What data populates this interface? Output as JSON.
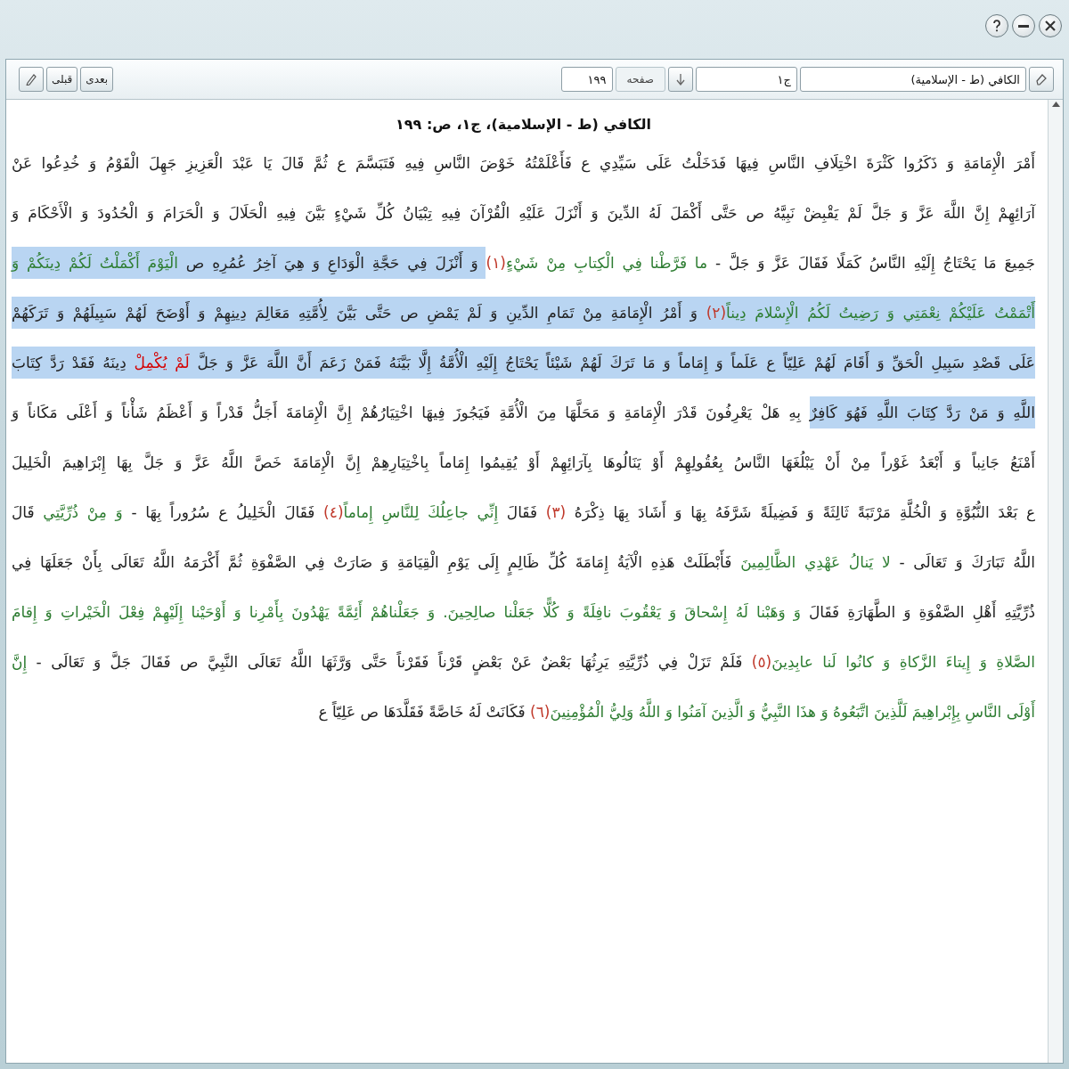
{
  "toolbar": {
    "book": "الكافي (ط - الإسلامية)",
    "volume": "ج١",
    "page_label": "صفحه",
    "page": "١٩٩",
    "prev": "قبلى",
    "next": "بعدى"
  },
  "document": {
    "heading": "الكافي (ط - الإسلامية)، ج١، ص: ١٩٩",
    "lines": [
      {
        "segments": [
          {
            "kind": "plain",
            "selected": false,
            "text": "أَمْرَ الْإِمَامَةِ وَ ذَكَرُوا كَثْرَةَ اخْتِلَافِ النَّاسِ فِيهَا فَدَخَلْتُ عَلَى سَيِّدِي ع فَأَعْلَمْتُهُ خَوْضَ النَّاسِ فِيهِ فَتَبَسَّمَ ع ثُمَّ قَالَ يَا عَبْدَ الْعَزِيزِ جَهِلَ الْقَوْمُ وَ خُدِعُوا عَنْ"
          }
        ]
      },
      {
        "segments": [
          {
            "kind": "plain",
            "selected": false,
            "text": "آرَائِهِمْ إِنَّ اللَّهَ عَزَّ وَ جَلَّ لَمْ يَقْبِضْ نَبِيَّهُ ص حَتَّى أَكْمَلَ لَهُ الدِّينَ وَ أَنْزَلَ عَلَيْهِ الْقُرْآنَ فِيهِ تِبْيَانُ كُلِّ شَيْءٍ بَيَّنَ فِيهِ الْحَلَالَ وَ الْحَرَامَ وَ الْحُدُودَ وَ الْأَحْكَامَ وَ"
          }
        ]
      },
      {
        "segments": [
          {
            "kind": "plain",
            "selected": false,
            "text": "جَمِيعَ مَا يَحْتَاجُ إِلَيْهِ النَّاسُ كَمَلًا فَقَالَ عَزَّ وَ جَلَّ - "
          },
          {
            "kind": "quran",
            "selected": false,
            "text": "ما فَرَّطْنا فِي الْكِتابِ مِنْ شَيْءٍ"
          },
          {
            "kind": "note",
            "selected": false,
            "text": "(١)"
          },
          {
            "kind": "plain",
            "selected": true,
            "text": " وَ أَنْزَلَ فِي حَجَّةِ الْوَدَاعِ وَ هِيَ آخِرُ عُمُرِهِ ص "
          },
          {
            "kind": "quran",
            "selected": true,
            "text": "الْيَوْمَ أَكْمَلْتُ لَكُمْ دِينَكُمْ وَ"
          }
        ]
      },
      {
        "segments": [
          {
            "kind": "quran",
            "selected": true,
            "text": "أَتْمَمْتُ عَلَيْكُمْ نِعْمَتِي وَ رَضِيتُ لَكُمُ الْإِسْلامَ دِيناً"
          },
          {
            "kind": "note",
            "selected": true,
            "text": "(٢)"
          },
          {
            "kind": "plain",
            "selected": true,
            "text": " وَ أَمْرُ الْإِمَامَةِ مِنْ تَمَامِ الدِّينِ وَ لَمْ يَمْضِ ص حَتَّى بَيَّنَ لِأُمَّتِهِ مَعَالِمَ دِينِهِمْ وَ أَوْضَحَ لَهُمْ سَبِيلَهُمْ وَ تَرَكَهُمْ"
          }
        ]
      },
      {
        "segments": [
          {
            "kind": "plain",
            "selected": true,
            "text": "عَلَى قَصْدِ سَبِيلِ الْحَقِّ وَ أَقَامَ لَهُمْ عَلِيّاً ع عَلَماً وَ إِمَاماً وَ مَا تَرَكَ لَهُمْ شَيْئاً يَحْتَاجُ إِلَيْهِ الْأُمَّةُ إِلَّا بَيَّنَهُ فَمَنْ زَعَمَ أَنَّ اللَّهَ عَزَّ وَ جَلَّ "
          },
          {
            "kind": "red",
            "selected": true,
            "text": "لَمْ يُكْمِلْ"
          },
          {
            "kind": "plain",
            "selected": true,
            "text": " دِينَهُ فَقَدْ رَدَّ كِتَابَ"
          }
        ]
      },
      {
        "segments": [
          {
            "kind": "plain",
            "selected": true,
            "text": "اللَّهِ وَ مَنْ رَدَّ كِتَابَ اللَّهِ فَهُوَ كَافِرٌ"
          },
          {
            "kind": "plain",
            "selected": false,
            "text": " بِهِ هَلْ يَعْرِفُونَ قَدْرَ الْإِمَامَةِ وَ مَحَلَّهَا مِنَ الْأُمَّةِ فَيَجُوزَ فِيهَا اخْتِيَارُهُمْ إِنَّ الْإِمَامَةَ أَجَلُّ قَدْراً وَ أَعْظَمُ شَأْناً وَ أَعْلَى مَكَاناً وَ"
          }
        ]
      },
      {
        "segments": [
          {
            "kind": "plain",
            "selected": false,
            "text": "أَمْنَعُ جَانِباً وَ أَبْعَدُ غَوْراً مِنْ أَنْ يَبْلُغَهَا النَّاسُ بِعُقُولِهِمْ أَوْ يَنَالُوهَا بِآرَائِهِمْ أَوْ يُقِيمُوا إِمَاماً بِاخْتِيَارِهِمْ إِنَّ الْإِمَامَةَ خَصَّ اللَّهُ عَزَّ وَ جَلَّ بِهَا إِبْرَاهِيمَ الْخَلِيلَ"
          }
        ]
      },
      {
        "segments": [
          {
            "kind": "plain",
            "selected": false,
            "text": "ع بَعْدَ النُّبُوَّةِ وَ الْخُلَّةِ مَرْتَبَةً ثَالِثَةً وَ فَضِيلَةً شَرَّفَهُ بِهَا وَ أَشَادَ بِهَا ذِكْرَهُ "
          },
          {
            "kind": "note",
            "selected": false,
            "text": "(٣)"
          },
          {
            "kind": "plain",
            "selected": false,
            "text": " فَقَالَ "
          },
          {
            "kind": "quran",
            "selected": false,
            "text": "إِنِّي جاعِلُكَ لِلنَّاسِ إِماماً"
          },
          {
            "kind": "note",
            "selected": false,
            "text": "(٤)"
          },
          {
            "kind": "plain",
            "selected": false,
            "text": " فَقَالَ الْخَلِيلُ ع سُرُوراً بِهَا - "
          },
          {
            "kind": "quran",
            "selected": false,
            "text": "وَ مِنْ ذُرِّيَّتِي"
          },
          {
            "kind": "plain",
            "selected": false,
            "text": " قَالَ"
          }
        ]
      },
      {
        "segments": [
          {
            "kind": "plain",
            "selected": false,
            "text": "اللَّهُ تَبَارَكَ وَ تَعَالَى - "
          },
          {
            "kind": "quran",
            "selected": false,
            "text": "لا يَنالُ عَهْدِي الظَّالِمِينَ"
          },
          {
            "kind": "plain",
            "selected": false,
            "text": " فَأَبْطَلَتْ هَذِهِ الْآيَةُ إِمَامَةَ كُلِّ ظَالِمٍ إِلَى يَوْمِ الْقِيَامَةِ وَ صَارَتْ فِي الصَّفْوَةِ ثُمَّ أَكْرَمَهُ اللَّهُ تَعَالَى بِأَنْ جَعَلَهَا فِي"
          }
        ]
      },
      {
        "segments": [
          {
            "kind": "plain",
            "selected": false,
            "text": "ذُرِّيَّتِهِ أَهْلِ الصَّفْوَةِ وَ الطَّهَارَةِ فَقَالَ "
          },
          {
            "kind": "quran",
            "selected": false,
            "text": "وَ وَهَبْنا لَهُ إِسْحاقَ وَ يَعْقُوبَ نافِلَةً وَ كُلًّا جَعَلْنا صالِحِينَ. وَ جَعَلْناهُمْ أَئِمَّةً يَهْدُونَ بِأَمْرِنا وَ أَوْحَيْنا إِلَيْهِمْ فِعْلَ الْخَيْراتِ وَ إِقامَ"
          }
        ]
      },
      {
        "segments": [
          {
            "kind": "quran",
            "selected": false,
            "text": "الصَّلاةِ وَ إِيتاءَ الزَّكاةِ وَ كانُوا لَنا عابِدِينَ"
          },
          {
            "kind": "note",
            "selected": false,
            "text": "(٥)"
          },
          {
            "kind": "plain",
            "selected": false,
            "text": " فَلَمْ تَزَلْ فِي ذُرِّيَّتِهِ يَرِثُهَا بَعْضٌ عَنْ بَعْضٍ قَرْناً فَقَرْناً حَتَّى وَرَّثَهَا اللَّهُ تَعَالَى النَّبِيَّ ص فَقَالَ جَلَّ وَ تَعَالَى - "
          },
          {
            "kind": "quran",
            "selected": false,
            "text": "إِنَّ"
          }
        ]
      },
      {
        "segments": [
          {
            "kind": "quran",
            "selected": false,
            "text": "أَوْلَى النَّاسِ بِإِبْراهِيمَ لَلَّذِينَ اتَّبَعُوهُ وَ هذَا النَّبِيُّ وَ الَّذِينَ آمَنُوا وَ اللَّهُ وَلِيُّ الْمُؤْمِنِينَ"
          },
          {
            "kind": "note",
            "selected": false,
            "text": "(٦)"
          },
          {
            "kind": "plain",
            "selected": false,
            "text": " فَكَانَتْ لَهُ خَاصَّةً فَقَلَّدَهَا ص عَلِيّاً ع"
          }
        ]
      }
    ]
  }
}
